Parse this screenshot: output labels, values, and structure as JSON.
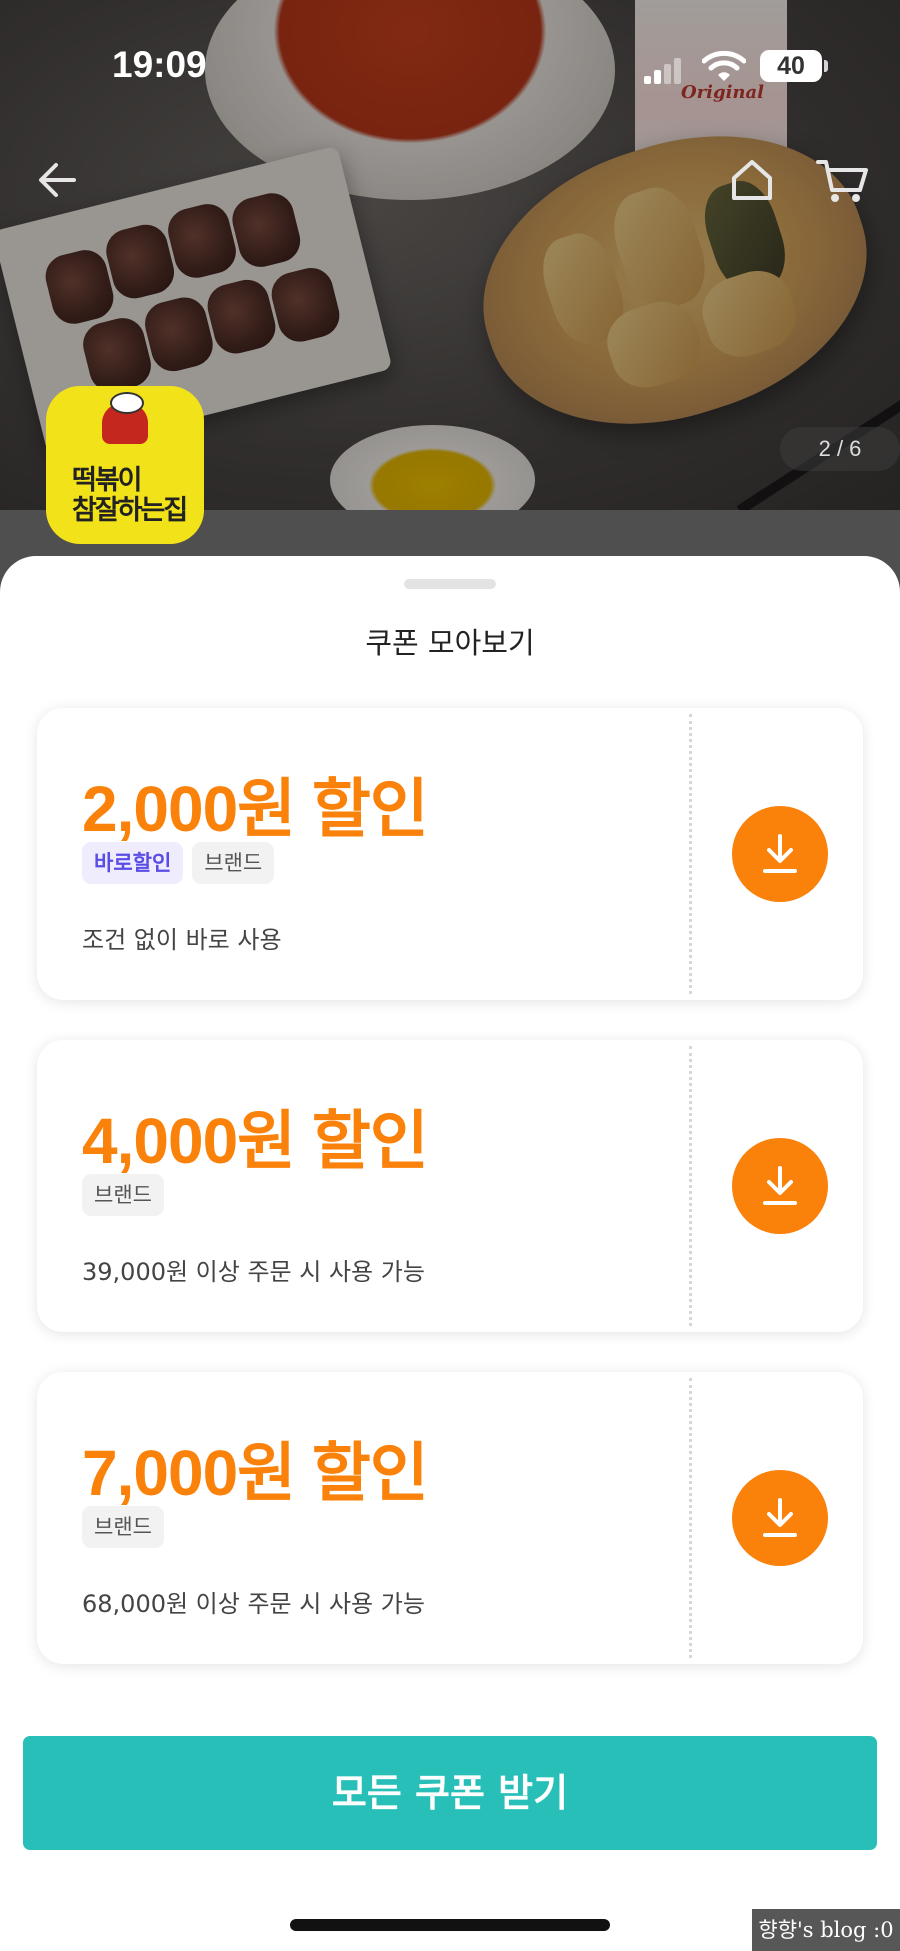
{
  "status_bar": {
    "time": "19:09",
    "battery": "40"
  },
  "header": {
    "back_icon": "arrow-left-icon",
    "home_icon": "home-icon",
    "cart_icon": "cart-icon",
    "image_counter": "2 / 6",
    "carton_text": "Original"
  },
  "store": {
    "logo_line1": "떡볶이",
    "logo_line2": "참잘하는집"
  },
  "sheet": {
    "title": "쿠폰 모아보기",
    "coupons": [
      {
        "amount": "2,000원 할인",
        "tags": [
          "바로할인",
          "브랜드"
        ],
        "condition": "조건 없이 바로 사용"
      },
      {
        "amount": "4,000원 할인",
        "tags": [
          "브랜드"
        ],
        "condition": "39,000원 이상 주문 시 사용 가능"
      },
      {
        "amount": "7,000원 할인",
        "tags": [
          "브랜드"
        ],
        "condition": "68,000원 이상 주문 시 사용 가능"
      }
    ],
    "download_icon": "download-icon",
    "get_all_label": "모든 쿠폰 받기"
  },
  "watermark": "향향's blog :0",
  "colors": {
    "accent_orange": "#fa820a",
    "teal_button": "#27bfb8",
    "tag_purple": "#5a4de6"
  }
}
